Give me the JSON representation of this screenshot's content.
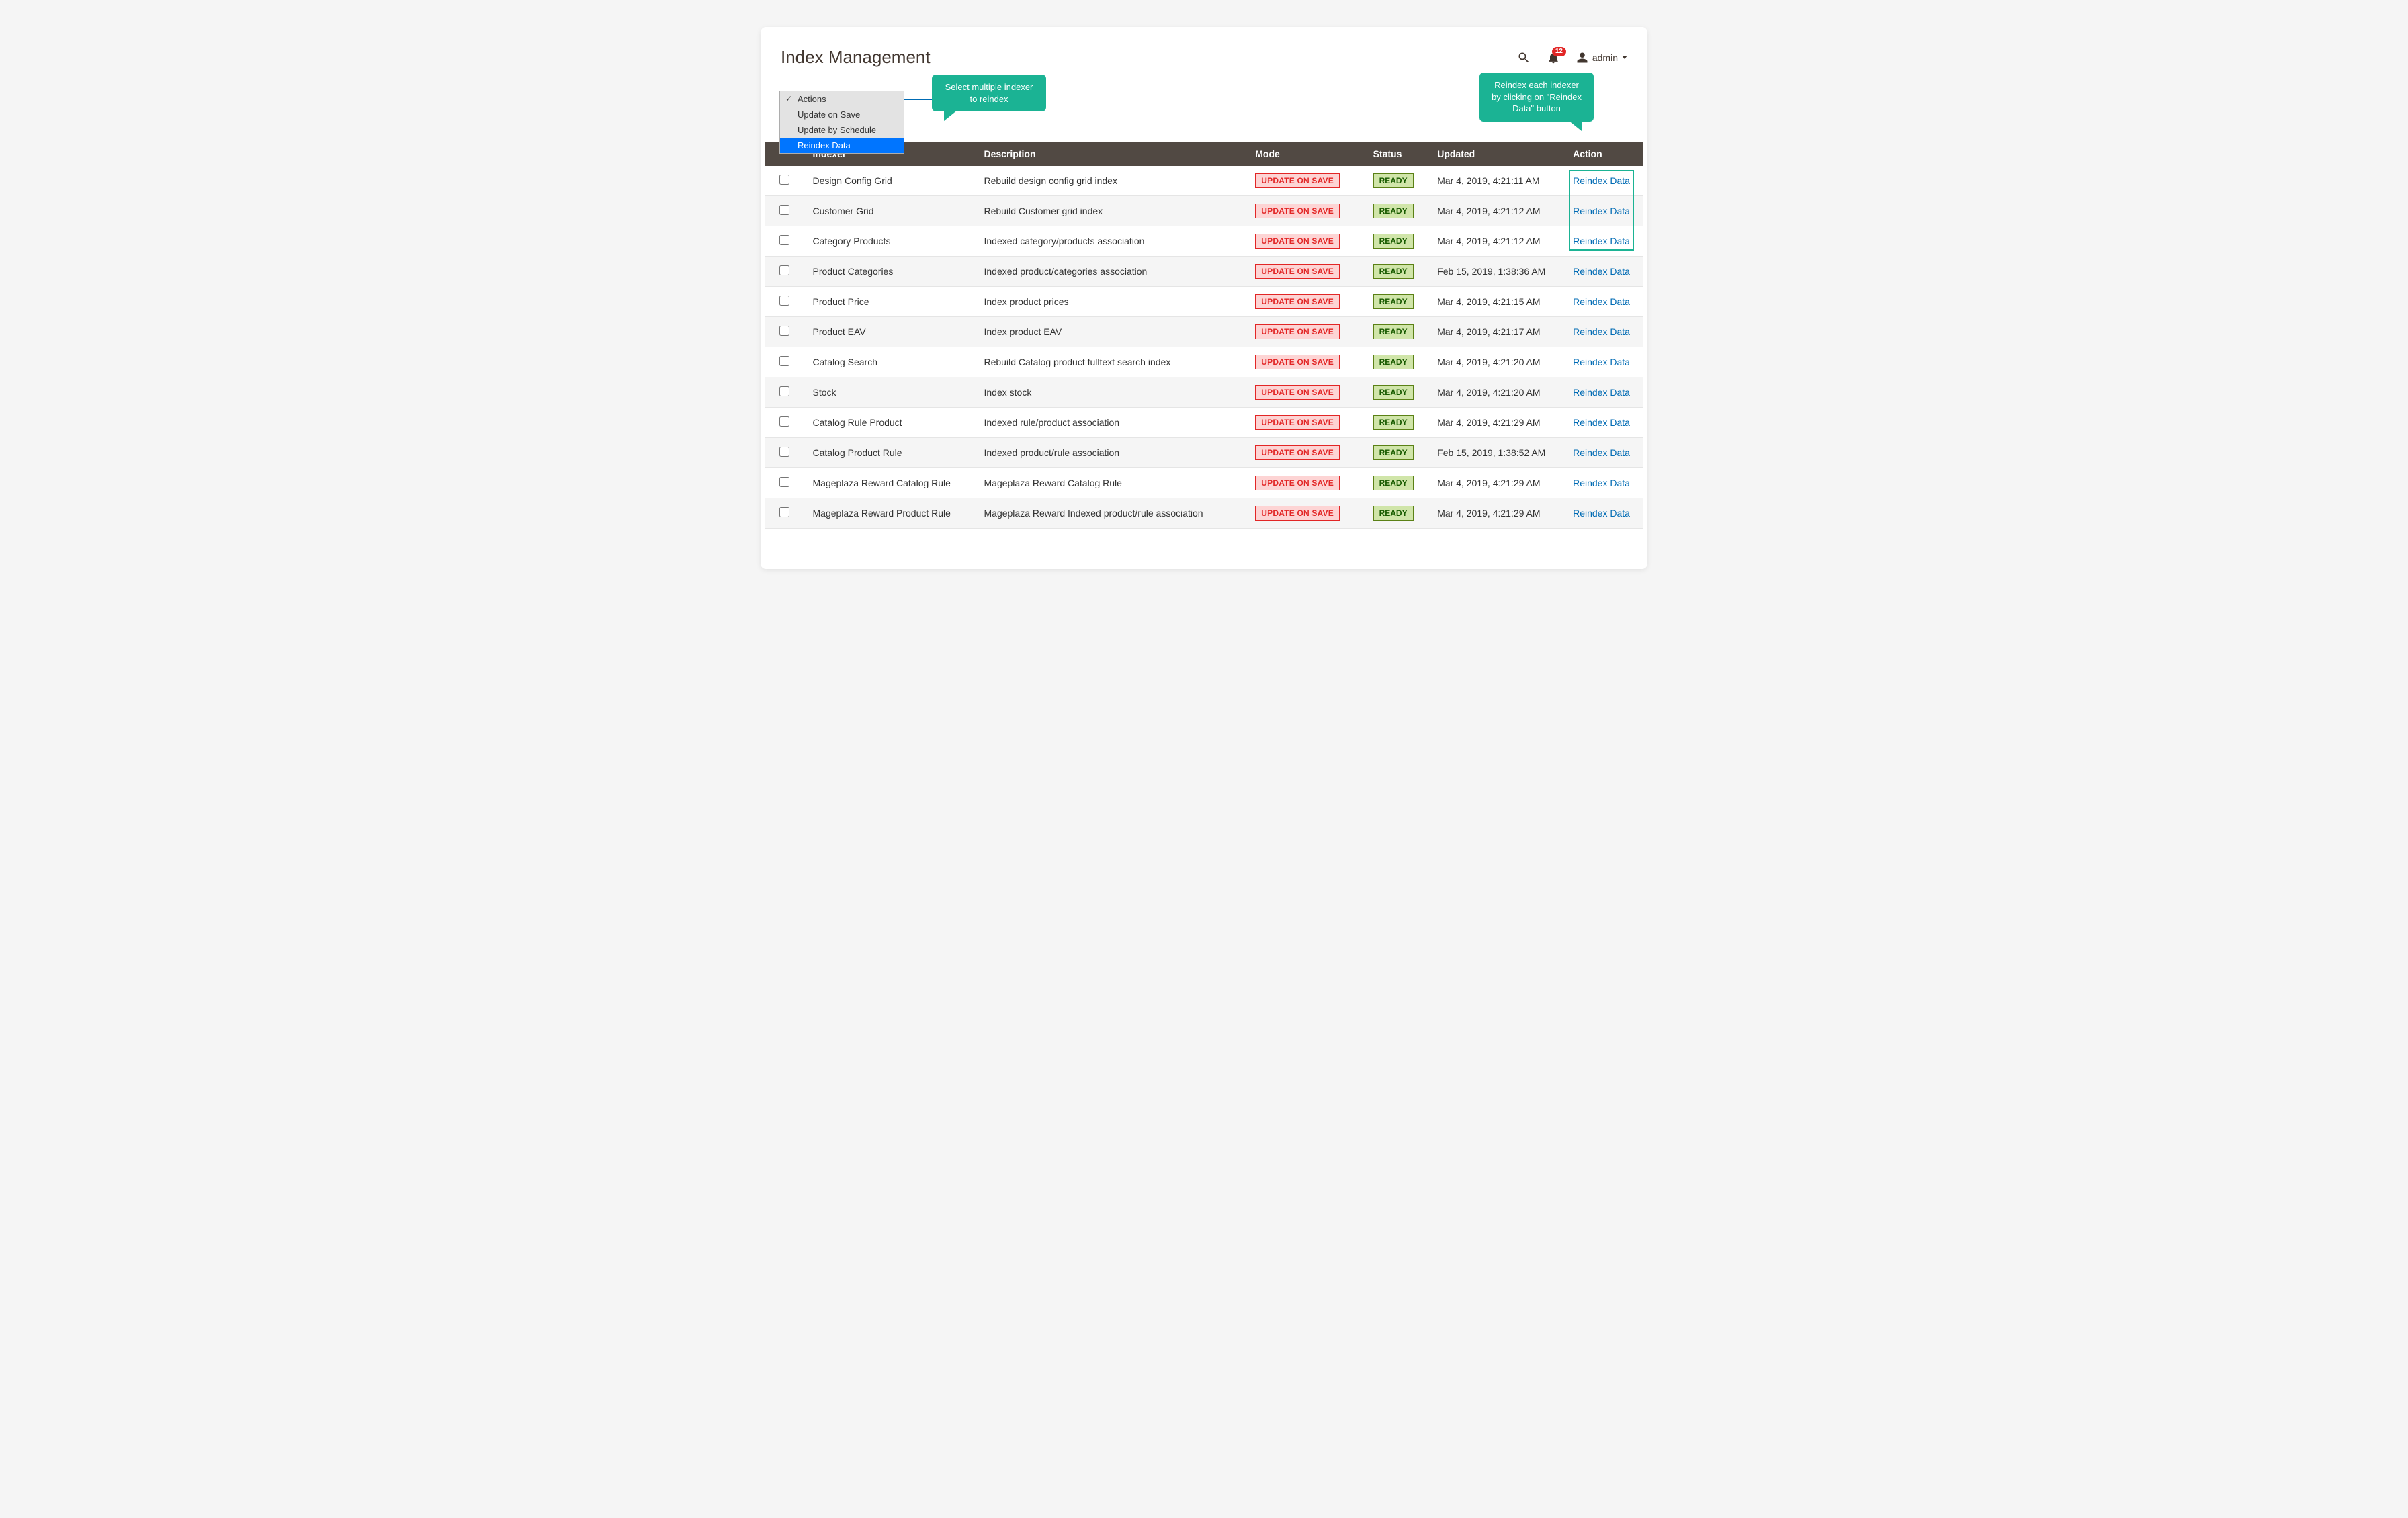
{
  "header": {
    "title": "Index Management",
    "notification_count": "12",
    "user_label": "admin"
  },
  "actions_dropdown": {
    "items": [
      {
        "label": "Actions",
        "checked": true
      },
      {
        "label": "Update on Save"
      },
      {
        "label": "Update by Schedule"
      },
      {
        "label": "Reindex Data",
        "selected": true
      }
    ]
  },
  "callouts": {
    "left": "Select multiple indexer to reindex",
    "right": "Reindex each indexer by clicking on \"Reindex Data\" button"
  },
  "table": {
    "headers": {
      "indexer": "Indexer",
      "description": "Description",
      "mode": "Mode",
      "status": "Status",
      "updated": "Updated",
      "action": "Action"
    },
    "mode_label": "UPDATE ON SAVE",
    "status_label": "READY",
    "action_label": "Reindex Data",
    "rows": [
      {
        "indexer": "Design Config Grid",
        "description": "Rebuild design config grid index",
        "updated": "Mar 4, 2019, 4:21:11 AM"
      },
      {
        "indexer": "Customer Grid",
        "description": "Rebuild Customer grid index",
        "updated": "Mar 4, 2019, 4:21:12 AM"
      },
      {
        "indexer": "Category Products",
        "description": "Indexed category/products association",
        "updated": "Mar 4, 2019, 4:21:12 AM"
      },
      {
        "indexer": "Product Categories",
        "description": "Indexed product/categories association",
        "updated": "Feb 15, 2019, 1:38:36 AM"
      },
      {
        "indexer": "Product Price",
        "description": "Index product prices",
        "updated": "Mar 4, 2019, 4:21:15 AM"
      },
      {
        "indexer": "Product EAV",
        "description": "Index product EAV",
        "updated": "Mar 4, 2019, 4:21:17 AM"
      },
      {
        "indexer": "Catalog Search",
        "description": "Rebuild Catalog product fulltext search index",
        "updated": "Mar 4, 2019, 4:21:20 AM"
      },
      {
        "indexer": "Stock",
        "description": "Index stock",
        "updated": "Mar 4, 2019, 4:21:20 AM"
      },
      {
        "indexer": "Catalog Rule Product",
        "description": "Indexed rule/product association",
        "updated": "Mar 4, 2019, 4:21:29 AM"
      },
      {
        "indexer": "Catalog Product Rule",
        "description": "Indexed product/rule association",
        "updated": "Feb 15, 2019, 1:38:52 AM"
      },
      {
        "indexer": "Mageplaza Reward Catalog Rule",
        "description": "Mageplaza Reward Catalog Rule",
        "updated": "Mar 4, 2019, 4:21:29 AM"
      },
      {
        "indexer": "Mageplaza Reward Product Rule",
        "description": "Mageplaza Reward Indexed product/rule association",
        "updated": "Mar 4, 2019, 4:21:29 AM"
      }
    ]
  }
}
